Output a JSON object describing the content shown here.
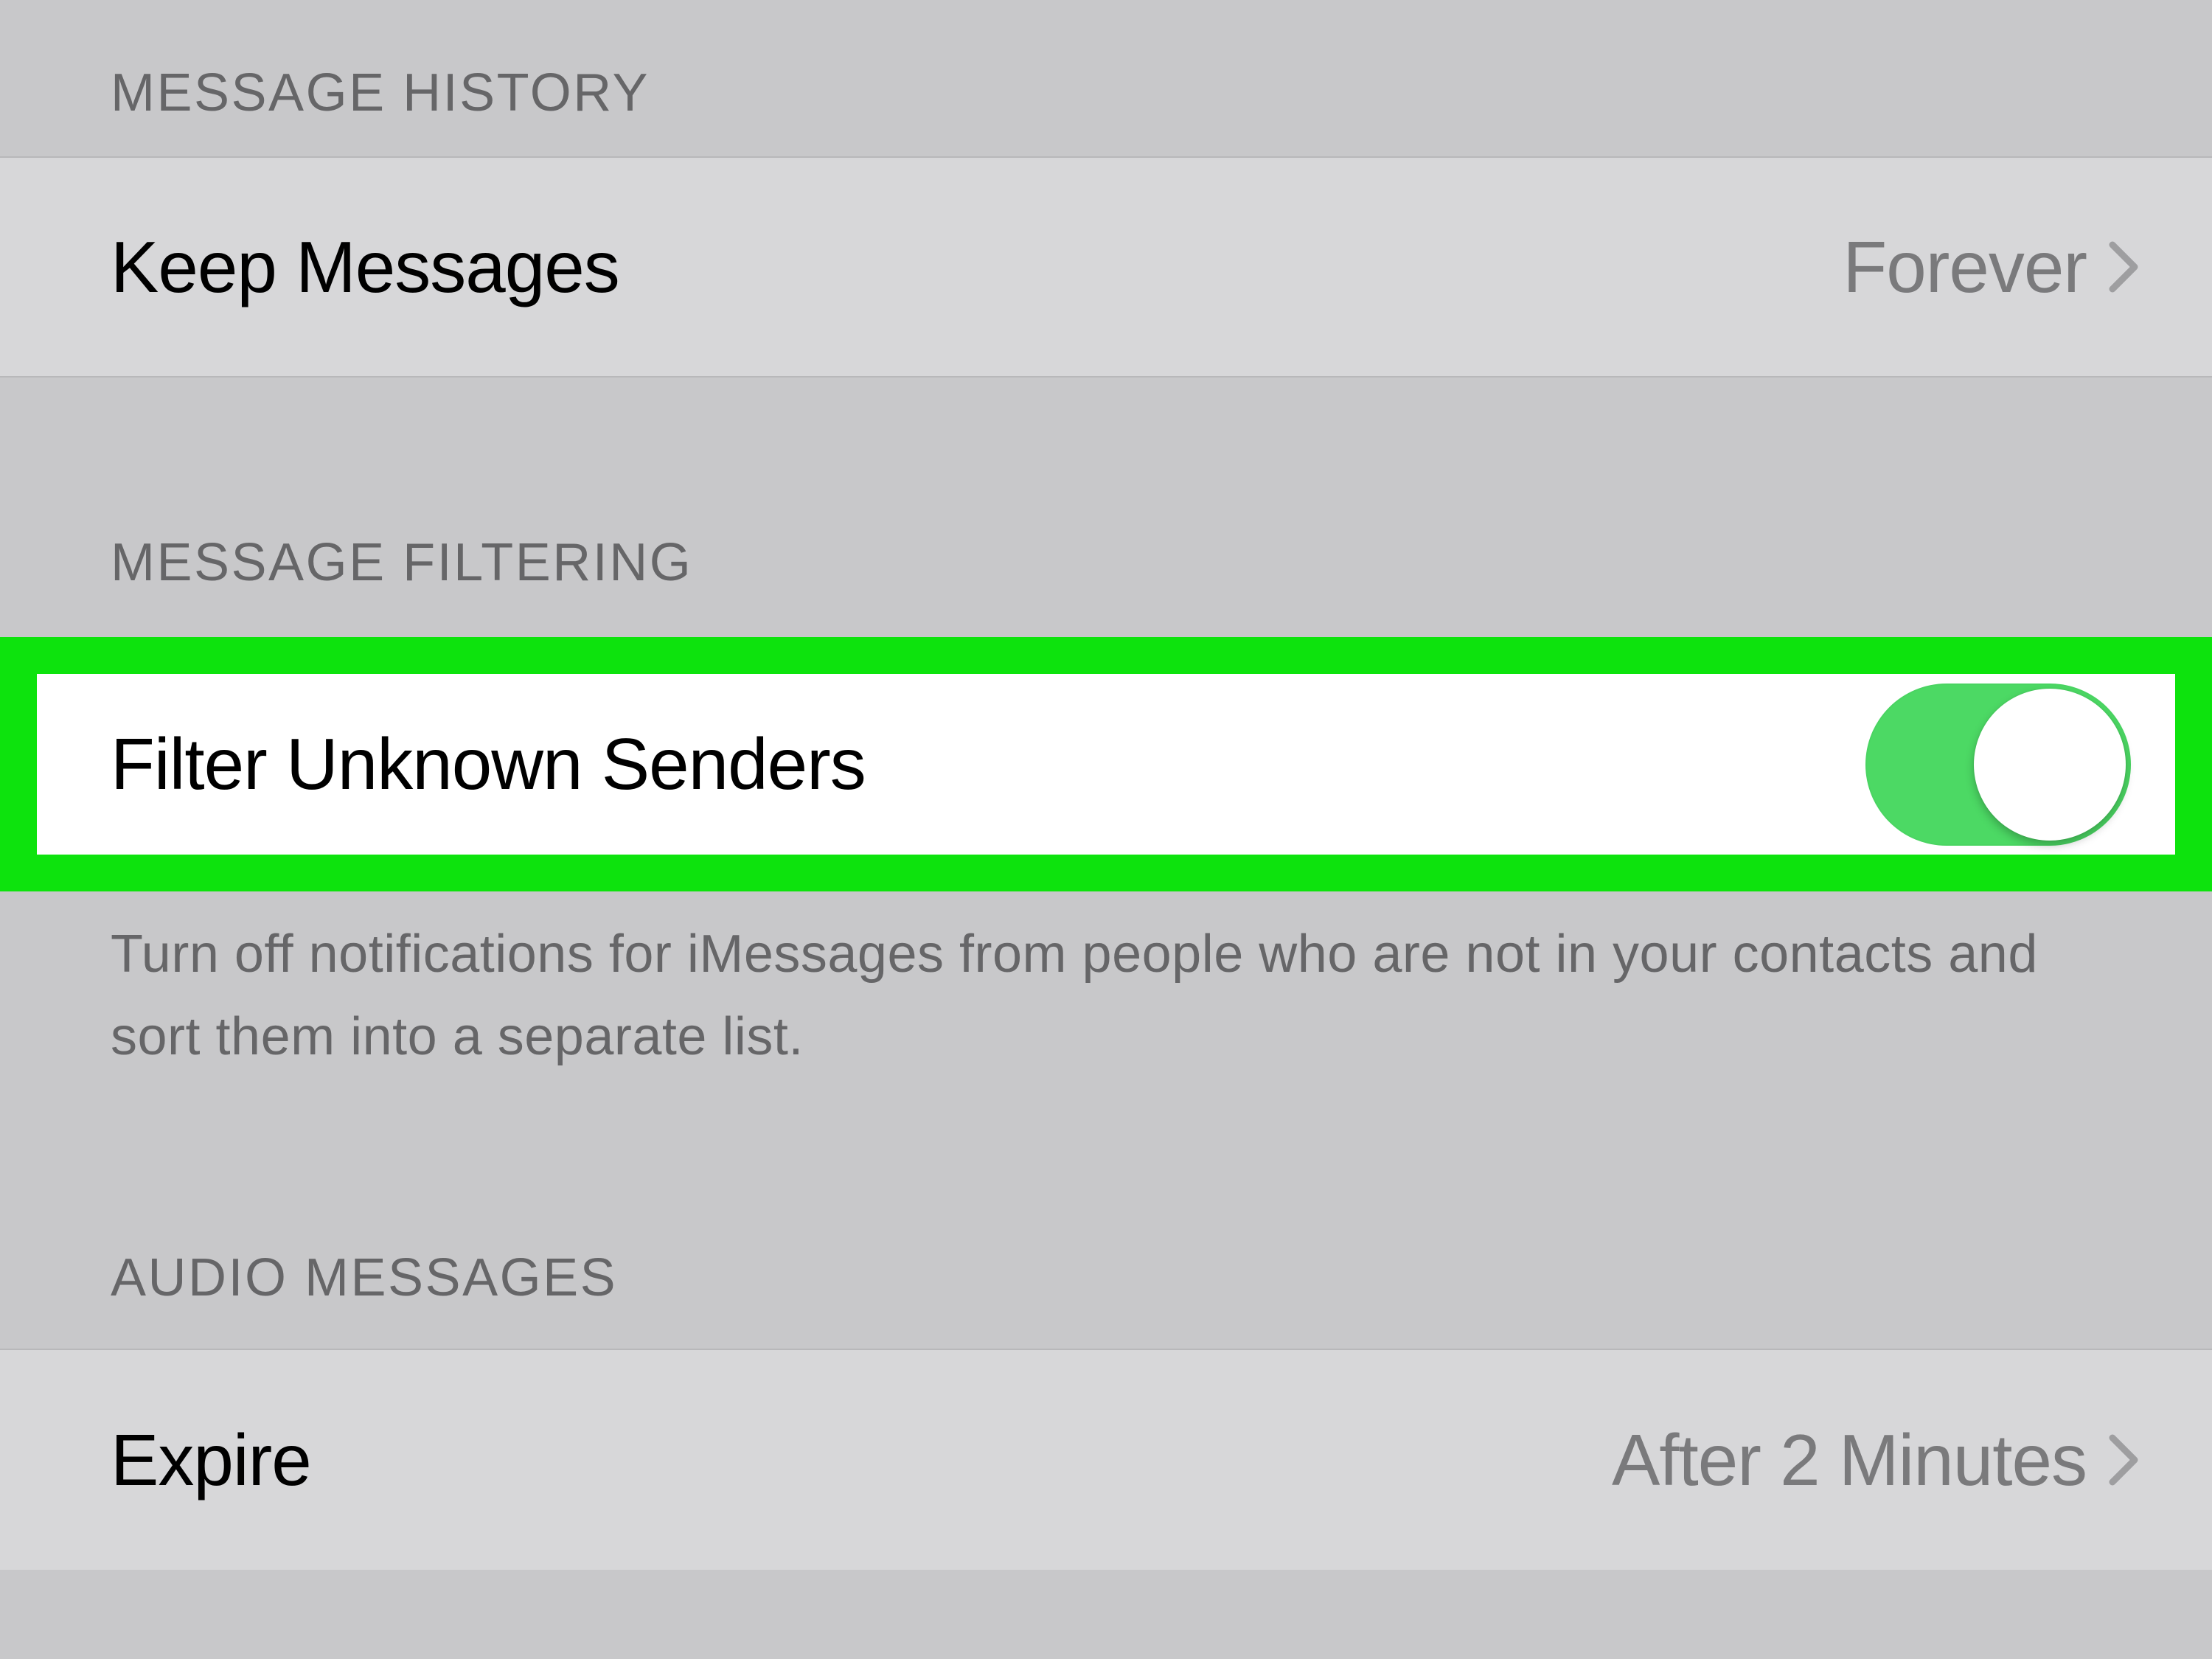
{
  "sections": {
    "message_history": {
      "header": "MESSAGE HISTORY",
      "keep_messages": {
        "label": "Keep Messages",
        "value": "Forever"
      }
    },
    "message_filtering": {
      "header": "MESSAGE FILTERING",
      "filter_unknown": {
        "label": "Filter Unknown Senders",
        "enabled": true
      },
      "footer": "Turn off notifications for iMessages from people who are not in your contacts and sort them into a separate list."
    },
    "audio_messages": {
      "header": "AUDIO MESSAGES",
      "expire": {
        "label": "Expire",
        "value": "After 2 Minutes"
      }
    }
  },
  "colors": {
    "toggle_on": "#4cd964",
    "highlight_border": "#0de30d"
  }
}
